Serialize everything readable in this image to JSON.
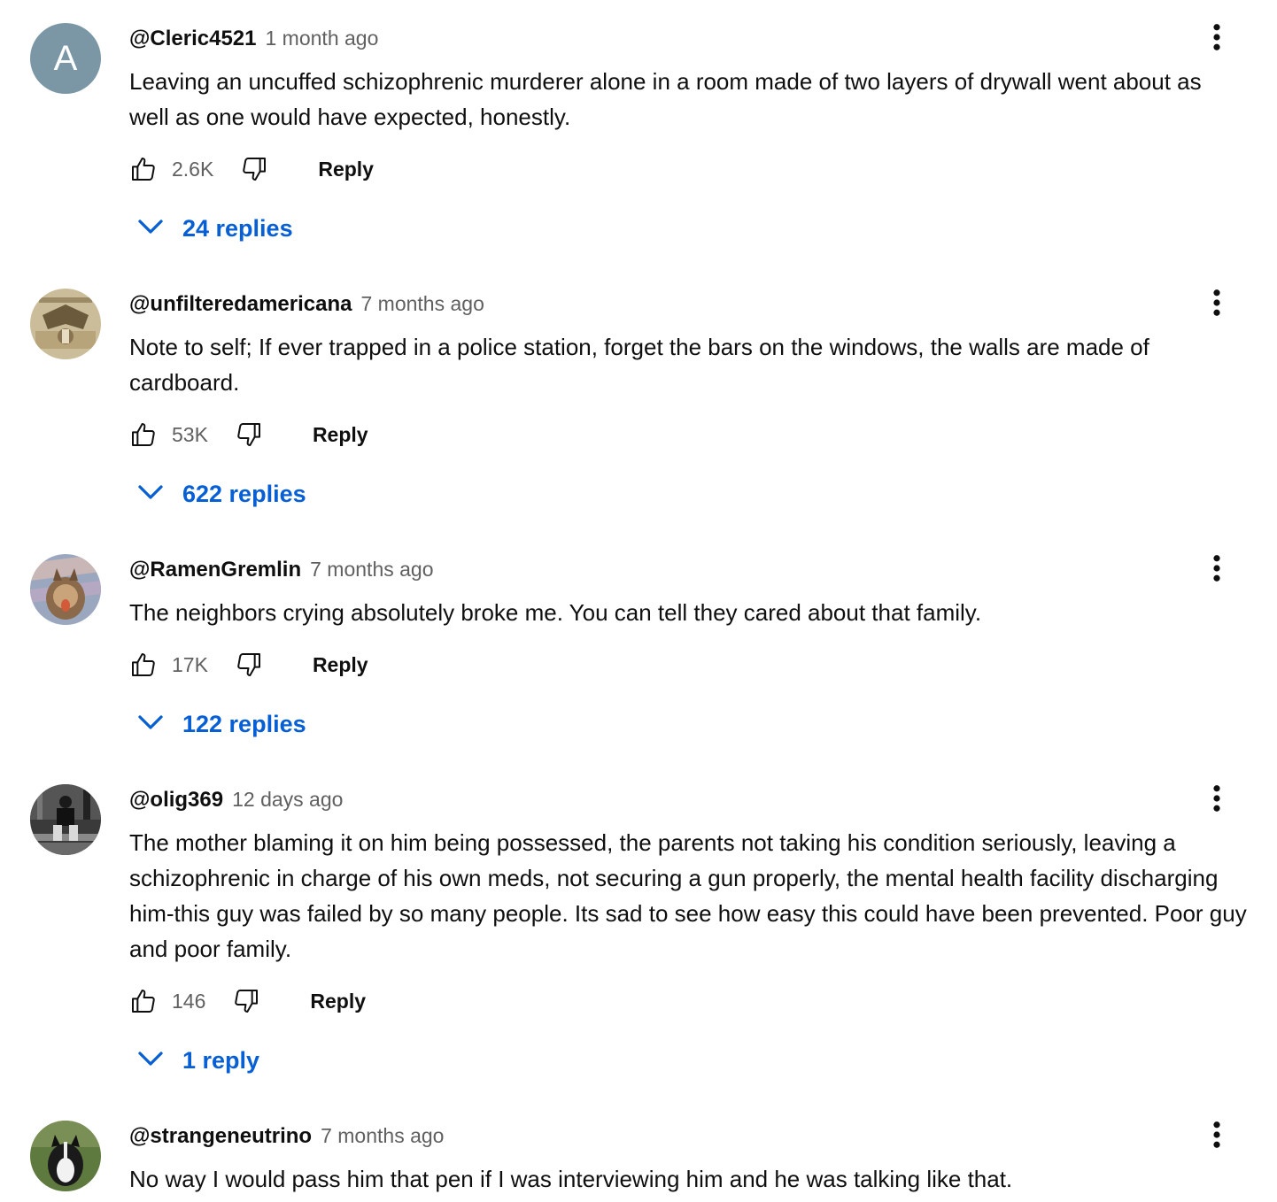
{
  "comments": [
    {
      "author": "@Cleric4521",
      "time": "1 month ago",
      "avatar_letter": "A",
      "text": "Leaving an uncuffed schizophrenic murderer alone in a room made of two layers of drywall went about as well as one would have expected, honestly.",
      "likes": "2.6K",
      "reply_label": "Reply",
      "replies_label": "24 replies"
    },
    {
      "author": "@unfilteredamericana",
      "time": "7 months ago",
      "text": "Note to self; If ever trapped in a police station, forget the bars on the windows, the walls are made of cardboard.",
      "likes": "53K",
      "reply_label": "Reply",
      "replies_label": "622 replies"
    },
    {
      "author": "@RamenGremlin",
      "time": "7 months ago",
      "text": "The neighbors crying absolutely broke me. You can tell they cared about that family.",
      "likes": "17K",
      "reply_label": "Reply",
      "replies_label": "122 replies"
    },
    {
      "author": "@olig369",
      "time": "12 days ago",
      "text": "The mother blaming it on him being possessed, the parents not taking his condition seriously, leaving a schizophrenic in charge of his own meds, not securing a gun properly, the mental health facility discharging him-this guy was failed by so many people. Its sad to see how easy this could have been prevented. Poor guy and poor family.",
      "likes": "146",
      "reply_label": "Reply",
      "replies_label": "1 reply"
    },
    {
      "author": "@strangeneutrino",
      "time": "7 months ago",
      "text": "No way I would pass him that pen if I was interviewing him and he was talking like that."
    }
  ],
  "colors": {
    "link_blue": "#065fd4",
    "secondary_text": "#606060",
    "primary_text": "#0f0f0f",
    "avatar_a_bg": "#7b97a6"
  },
  "icons": [
    "thumb-up-icon",
    "thumb-down-icon",
    "chevron-down-icon",
    "more-vert-icon"
  ]
}
